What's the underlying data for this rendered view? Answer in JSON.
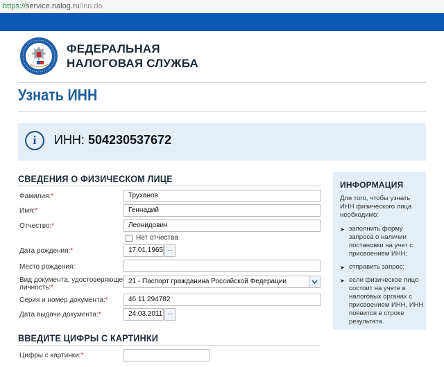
{
  "browser": {
    "url_scheme": "https://",
    "url_host": "service.nalog.ru",
    "url_path": "/inn.do"
  },
  "header": {
    "org_line1": "ФЕДЕРАЛЬНАЯ",
    "org_line2": "НАЛОГОВАЯ СЛУЖБА",
    "logo_ring_text": "ФЕДЕРАЛЬНАЯ НАЛОГОВАЯ СЛУЖБА"
  },
  "page_title": "Узнать ИНН",
  "result": {
    "icon": "i",
    "label": "ИНН:",
    "value": "504230537672"
  },
  "person_section": {
    "title": "СВЕДЕНИЯ О ФИЗИЧЕСКОМ ЛИЦЕ",
    "fields": {
      "surname": {
        "label": "Фамилия:",
        "value": "Труханов",
        "required": "*"
      },
      "name": {
        "label": "Имя:",
        "value": "Геннадий",
        "required": "*"
      },
      "patronymic": {
        "label": "Отчество:",
        "value": "Леонидович",
        "required": "*"
      },
      "no_patronymic": {
        "label": "Нет отчества"
      },
      "birth_date": {
        "label": "Дата рождения:",
        "value": "17.01.1965",
        "required": "*"
      },
      "birth_place": {
        "label": "Место рождения:",
        "value": ""
      },
      "doc_type": {
        "label_line1": "Вид документа, удостоверяющего",
        "label_line2": "личность:",
        "value": "21 - Паспорт гражданина Российской Федерации",
        "required": "*"
      },
      "doc_number": {
        "label": "Серия и номер документа:",
        "value": "46 11 294782",
        "required": "*"
      },
      "doc_date": {
        "label": "Дата выдачи документа:",
        "value": "24.03.2011",
        "required": "*"
      }
    },
    "calendar_button": "..."
  },
  "captcha_section": {
    "title": "ВВЕДИТЕ ЦИФРЫ С КАРТИНКИ",
    "label": "Цифры с картинки:",
    "required": "*",
    "value": ""
  },
  "sidebar": {
    "title": "ИНФОРМАЦИЯ",
    "intro": "Для того, чтобы узнать ИНН физического лица необходимо:",
    "items": [
      "заполнить форму запроса о наличии постановки на учет с присвоением ИНН;",
      "отправить запрос;",
      "если физическое лицо состоит на учете в налоговых органах с присвоением ИНН, ИНН появится в строке результата."
    ]
  },
  "colors": {
    "brand_blue": "#0a58b5",
    "title_blue": "#1c5d9e",
    "panel_bg": "#e4eef8",
    "required_red": "#d9232e"
  }
}
